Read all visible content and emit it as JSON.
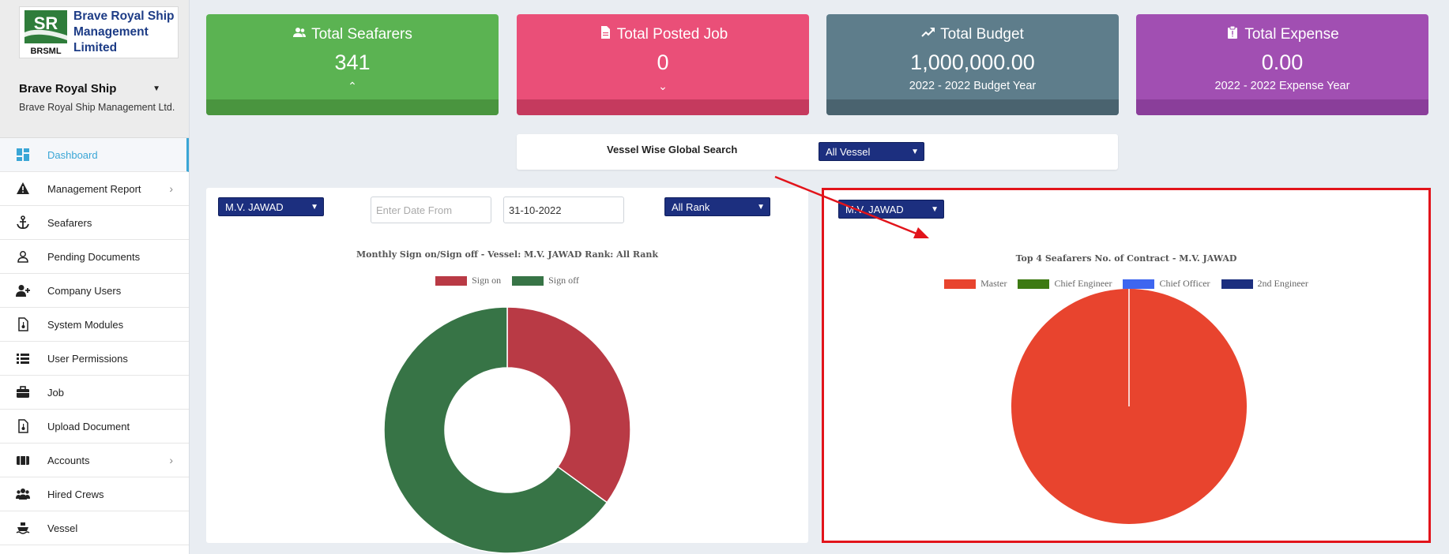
{
  "brand": {
    "logo_initials": "SR",
    "logo_sub": "BRSML",
    "name": "Brave Royal Ship Management Limited"
  },
  "user": {
    "name": "Brave Royal Ship",
    "org": "Brave Royal Ship Management Ltd."
  },
  "menu": [
    {
      "label": "Dashboard",
      "icon": "dashboard-icon",
      "active": true
    },
    {
      "label": "Management Report",
      "icon": "warning-icon",
      "has_children": true
    },
    {
      "label": "Seafarers",
      "icon": "anchor-icon"
    },
    {
      "label": "Pending Documents",
      "icon": "user-outline-icon"
    },
    {
      "label": "Company Users",
      "icon": "user-plus-icon"
    },
    {
      "label": "System Modules",
      "icon": "file-icon"
    },
    {
      "label": "User Permissions",
      "icon": "list-icon"
    },
    {
      "label": "Job",
      "icon": "briefcase-icon"
    },
    {
      "label": "Upload Document",
      "icon": "file-upload-icon"
    },
    {
      "label": "Accounts",
      "icon": "wallet-icon",
      "has_children": true
    },
    {
      "label": "Hired Crews",
      "icon": "users-icon"
    },
    {
      "label": "Vessel",
      "icon": "ship-icon"
    }
  ],
  "cards": [
    {
      "title": "Total Seafarers",
      "value": "341",
      "sub": "",
      "icon": "user-group-icon",
      "arrow": "up",
      "color": "#5bb352",
      "footer": "#4a953f"
    },
    {
      "title": "Total Posted Job",
      "value": "0",
      "sub": "",
      "icon": "document-icon",
      "arrow": "down",
      "color": "#ea4f78",
      "footer": "#c53a5e"
    },
    {
      "title": "Total Budget",
      "value": "1,000,000.00",
      "sub": "2022 - 2022 Budget Year",
      "icon": "trend-up-icon",
      "color": "#5e7d8b",
      "footer": "#4a636f"
    },
    {
      "title": "Total Expense",
      "value": "0.00",
      "sub": "2022 - 2022 Expense Year",
      "icon": "clipboard-icon",
      "color": "#a14fb2",
      "footer": "#8a3e9a"
    }
  ],
  "vessel_search": {
    "label": "Vessel Wise Global Search",
    "selected": "All Vessel"
  },
  "left_panel": {
    "vessel_selected": "M.V. JAWAD",
    "date_from_placeholder": "Enter Date From",
    "date_to_value": "31-10-2022",
    "rank_selected": "All Rank"
  },
  "right_panel": {
    "vessel_selected": "M.V. JAWAD"
  },
  "chart_data": [
    {
      "type": "pie",
      "subtype": "doughnut",
      "title": "Monthly Sign on/Sign off - Vessel: M.V. JAWAD Rank: All Rank",
      "categories": [
        "Sign on",
        "Sign off"
      ],
      "values": [
        35,
        65
      ],
      "colors": [
        "#b93a45",
        "#377446"
      ],
      "legend": "top"
    },
    {
      "type": "pie",
      "title": "Top 4 Seafarers No. of Contract - M.V. JAWAD",
      "categories": [
        "Master",
        "Chief Engineer",
        "Chief Officer",
        "2nd Engineer"
      ],
      "values": [
        1,
        0,
        0,
        0
      ],
      "colors": [
        "#e8442e",
        "#3d7a12",
        "#3e66f0",
        "#1c2f7f"
      ],
      "legend": "top"
    }
  ],
  "annotation": {
    "color": "#e2141b"
  }
}
